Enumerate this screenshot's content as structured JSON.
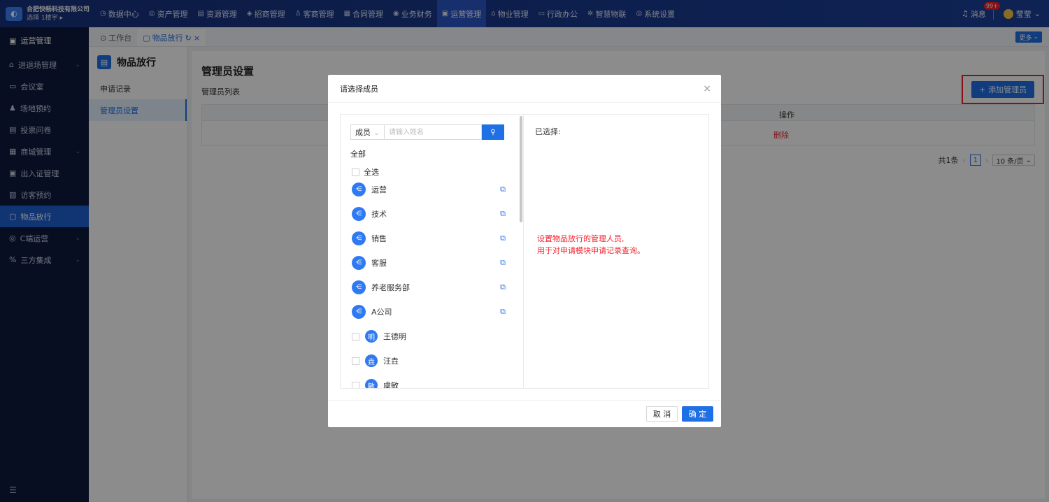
{
  "brand": {
    "name": "合肥快畅科技有限公司",
    "sub": "选择 1楼宇 ▸"
  },
  "nav": [
    {
      "label": "数据中心",
      "icon": "◷"
    },
    {
      "label": "资产管理",
      "icon": "◎"
    },
    {
      "label": "资源管理",
      "icon": "▤"
    },
    {
      "label": "招商管理",
      "icon": "◈"
    },
    {
      "label": "客商管理",
      "icon": "♙"
    },
    {
      "label": "合同管理",
      "icon": "▦"
    },
    {
      "label": "业务财务",
      "icon": "◉"
    },
    {
      "label": "运营管理",
      "icon": "▣"
    },
    {
      "label": "物业管理",
      "icon": "⌂"
    },
    {
      "label": "行政办公",
      "icon": "▭"
    },
    {
      "label": "智慧物联",
      "icon": "✲"
    },
    {
      "label": "系统设置",
      "icon": "◎"
    }
  ],
  "top_right": {
    "message": "消息",
    "badge": "99+",
    "user": "莹莹"
  },
  "sidebar": {
    "header": "运营管理",
    "items": [
      {
        "label": "进退场管理",
        "icon": "⌂",
        "chevron": true
      },
      {
        "label": "会议室",
        "icon": "▭"
      },
      {
        "label": "场地预约",
        "icon": "♟"
      },
      {
        "label": "投票问卷",
        "icon": "▤"
      },
      {
        "label": "商城管理",
        "icon": "▦",
        "chevron": true
      },
      {
        "label": "出入证管理",
        "icon": "▣"
      },
      {
        "label": "访客预约",
        "icon": "▧"
      },
      {
        "label": "物品放行",
        "icon": "▢"
      },
      {
        "label": "C端运营",
        "icon": "◎",
        "chevron": true
      },
      {
        "label": "三方集成",
        "icon": "%",
        "chevron": true
      }
    ],
    "bottom": "☰"
  },
  "tabs": [
    {
      "label": "工作台",
      "icon": "⊙"
    },
    {
      "label": "物品放行",
      "icon": "▢"
    }
  ],
  "more_label": "更多",
  "submenu": {
    "title": "物品放行",
    "items": [
      "申请记录",
      "管理员设置"
    ]
  },
  "content": {
    "title": "管理员设置",
    "list_label": "管理员列表",
    "add_button": "添加管理员",
    "ops_header": "操作",
    "delete": "删除",
    "total": "共1条",
    "page": "1",
    "page_size": "10 条/页"
  },
  "modal": {
    "title": "请选择成员",
    "search_type": "成员",
    "search_placeholder": "请输入姓名",
    "all": "全部",
    "select_all": "全选",
    "depts": [
      "运营",
      "技术",
      "销售",
      "客服",
      "养老服务部",
      "A公司"
    ],
    "members": [
      {
        "name": "王德明",
        "avatar": "明"
      },
      {
        "name": "汪垚",
        "avatar": "垚"
      },
      {
        "name": "虞敏",
        "avatar": "敏"
      }
    ],
    "selected_label": "已选择:",
    "note_line1": "设置物品放行的管理人员,",
    "note_line2": "用于对申请模块申请记录查询。",
    "cancel": "取 消",
    "ok": "确 定"
  },
  "colors": {
    "accent": "#1f6fe5",
    "topbar": "#1a3f99",
    "sidebar": "#0f1b3d",
    "danger": "#f5222d"
  }
}
